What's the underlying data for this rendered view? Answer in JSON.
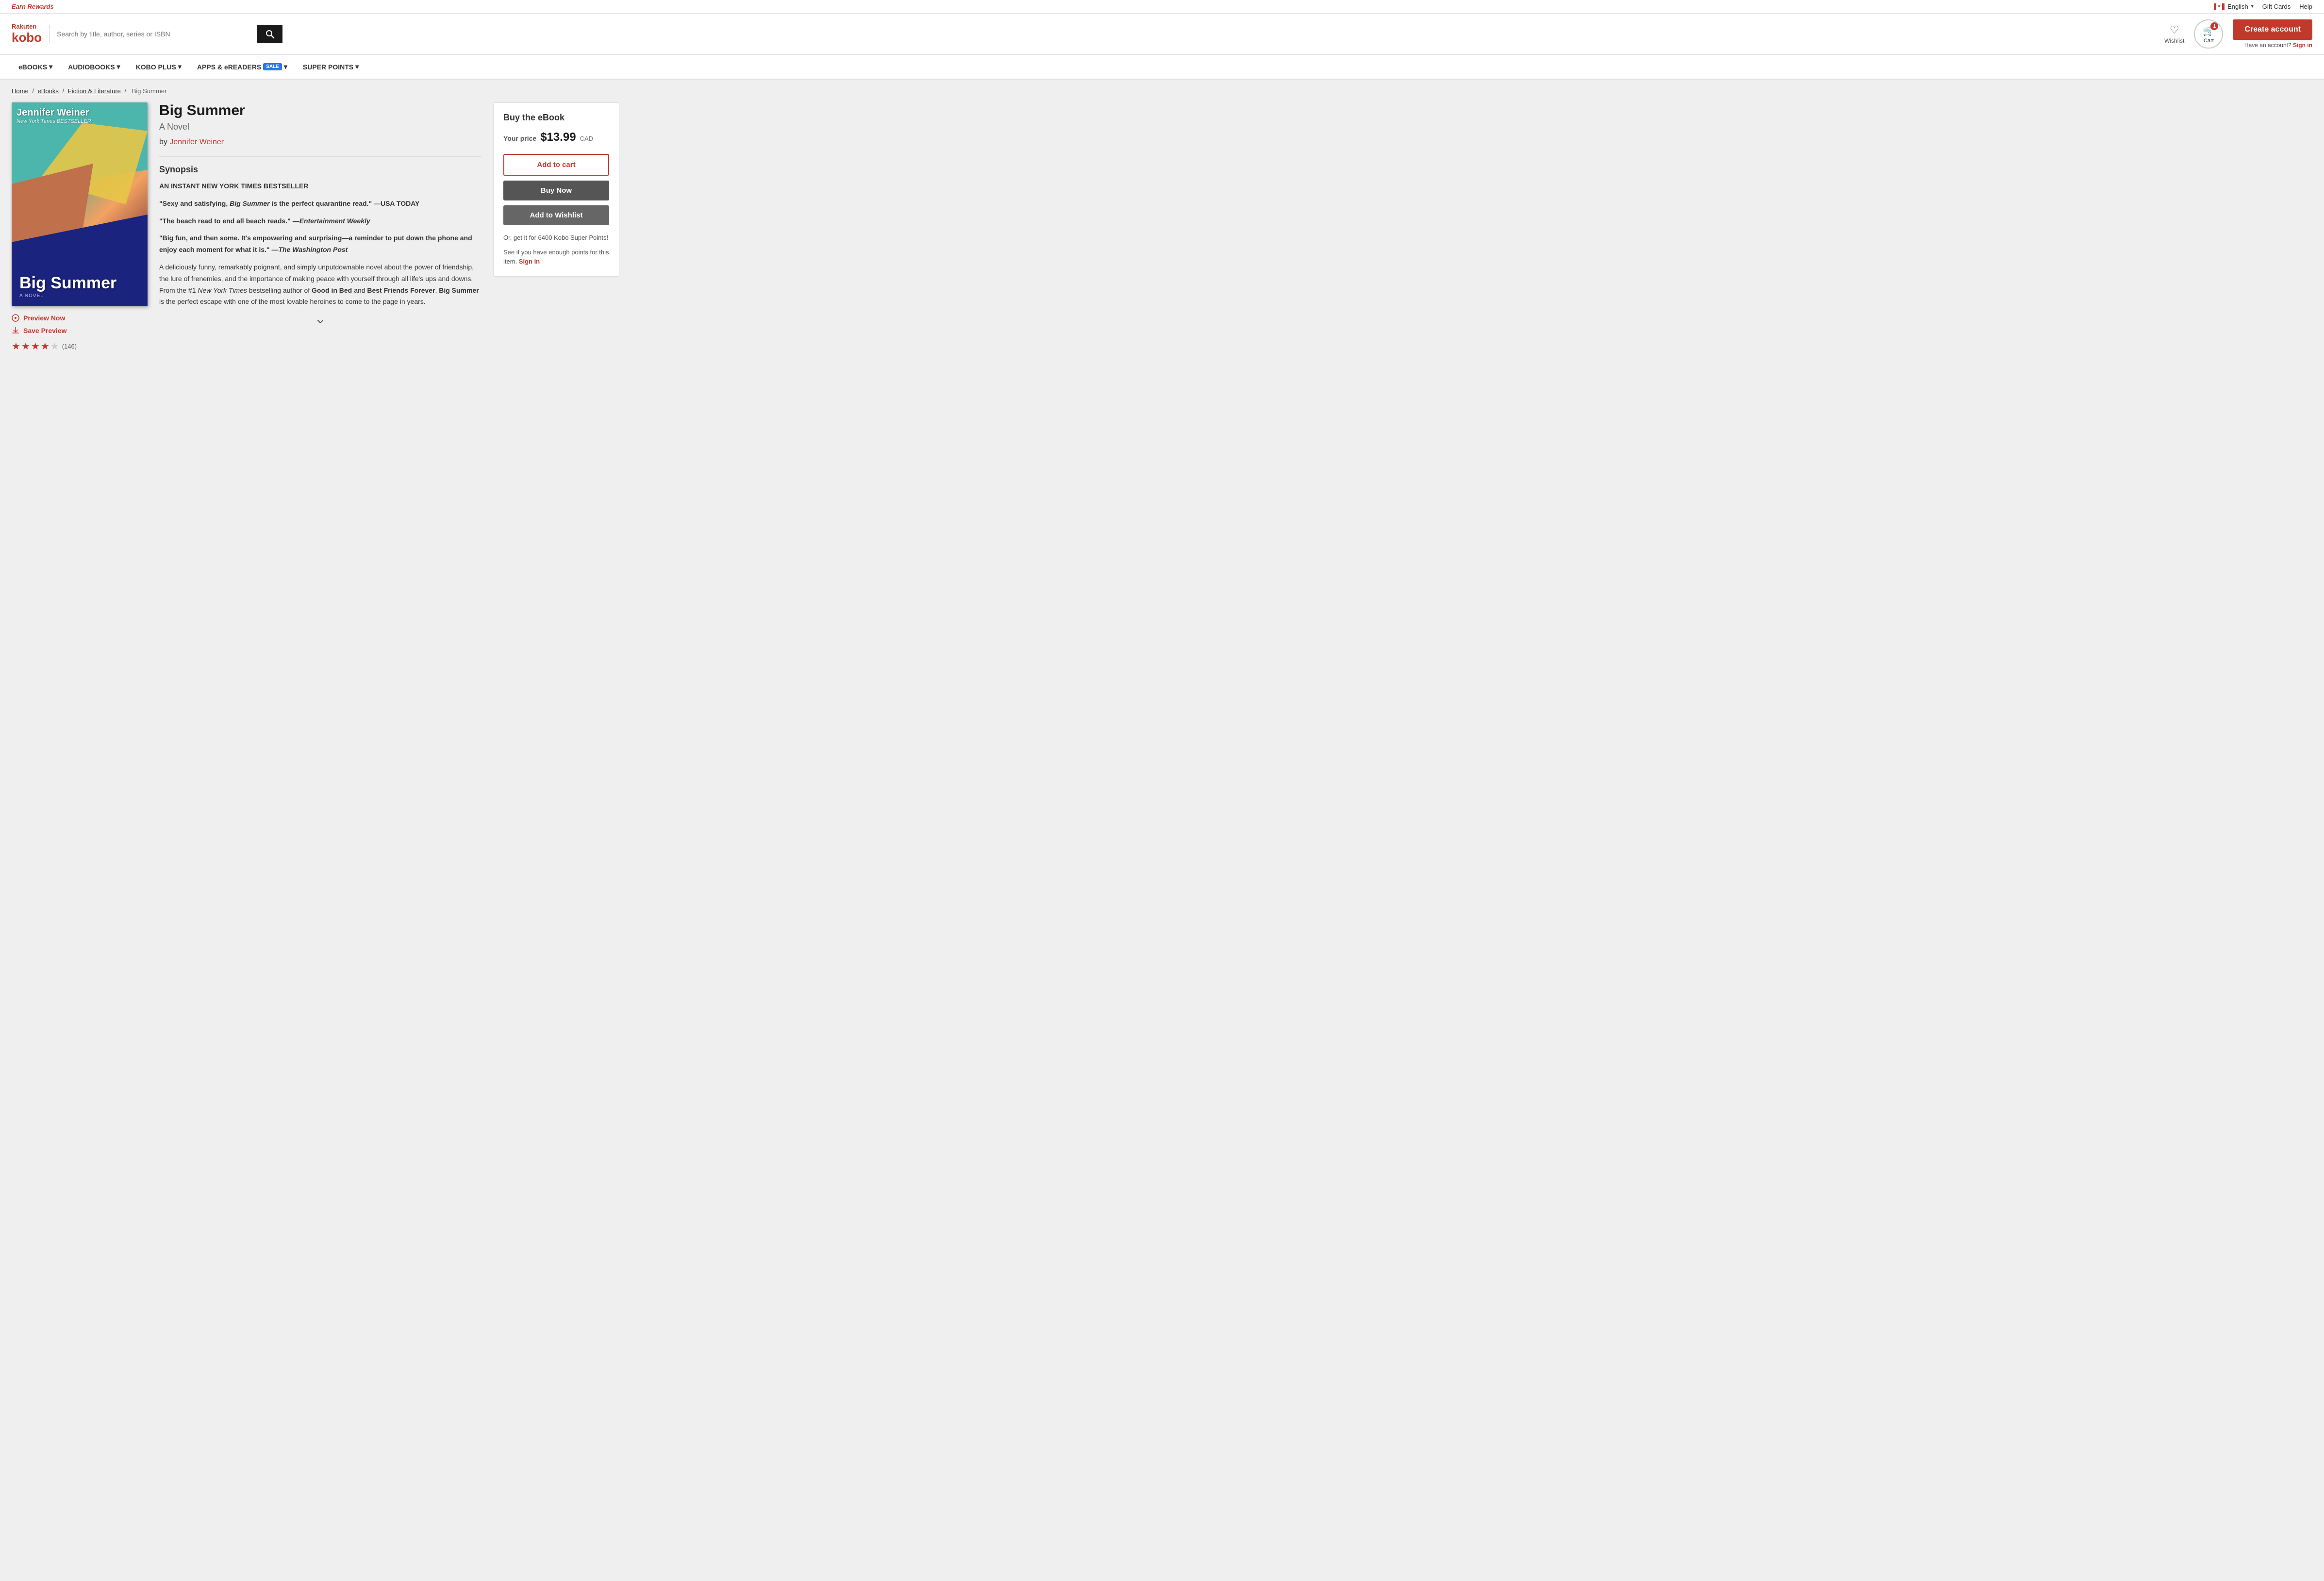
{
  "topbar": {
    "earn_rewards": "Earn Rewards",
    "language": "English",
    "gift_cards": "Gift Cards",
    "help": "Help",
    "chevron": "▾"
  },
  "header": {
    "logo_rakuten": "Rakuten",
    "logo_kobo": "kobo",
    "search_placeholder": "Search by title, author, series or ISBN",
    "wishlist_label": "Wishlist",
    "cart_label": "Cart",
    "cart_count": "1",
    "create_account": "Create account",
    "have_account": "Have an account?",
    "sign_in": "Sign in"
  },
  "nav": {
    "items": [
      {
        "label": "eBOOKS",
        "has_dropdown": true
      },
      {
        "label": "AUDIOBOOKS",
        "has_dropdown": true
      },
      {
        "label": "KOBO PLUS",
        "has_dropdown": true
      },
      {
        "label": "APPS & eREADERS",
        "has_dropdown": true,
        "badge": "SALE"
      },
      {
        "label": "SUPER POINTS",
        "has_dropdown": true
      }
    ]
  },
  "breadcrumb": {
    "home": "Home",
    "ebooks": "eBooks",
    "fiction": "Fiction & Literature",
    "current": "Big Summer"
  },
  "book": {
    "title": "Big Summer",
    "subtitle": "A Novel",
    "author_prefix": "by",
    "author": "Jennifer Weiner",
    "cover": {
      "author_top": "Jennifer Weiner",
      "bestseller": "New York Times BESTSELLER",
      "title": "Big Summer",
      "novel": "A NOVEL"
    },
    "synopsis_title": "Synopsis",
    "synopsis": [
      "AN INSTANT NEW YORK TIMES BESTSELLER",
      "\"Sexy and satisfying, Big Summer is the perfect quarantine read.\" —USA TODAY",
      "\"The beach read to end all beach reads.\" —Entertainment Weekly",
      "\"Big fun, and then some. It's empowering and surprising—a reminder to put down the phone and enjoy each moment for what it is.\" —The Washington Post",
      "A deliciously funny, remarkably poignant, and simply unputdownable novel about the power of friendship, the lure of frenemies, and the importance of making peace with yourself through all life's ups and downs. From the #1 New York Times bestselling author of Good in Bed and Best Friends Forever, Big Summer is the perfect escape with one of the most lovable heroines to come to the page in years."
    ],
    "preview_btn": "Preview Now",
    "save_preview_btn": "Save Preview",
    "rating_count": "(146)",
    "stars": [
      true,
      true,
      true,
      true,
      false
    ]
  },
  "purchase": {
    "title": "Buy the eBook",
    "price_label": "Your price",
    "price": "$13.99",
    "currency": "CAD",
    "add_to_cart": "Add to cart",
    "buy_now": "Buy Now",
    "add_wishlist": "Add to Wishlist",
    "kobo_points_text": "Or, get it for 6400 Kobo Super Points!",
    "sign_in_prompt": "See if you have enough points for this item.",
    "sign_in": "Sign in"
  }
}
